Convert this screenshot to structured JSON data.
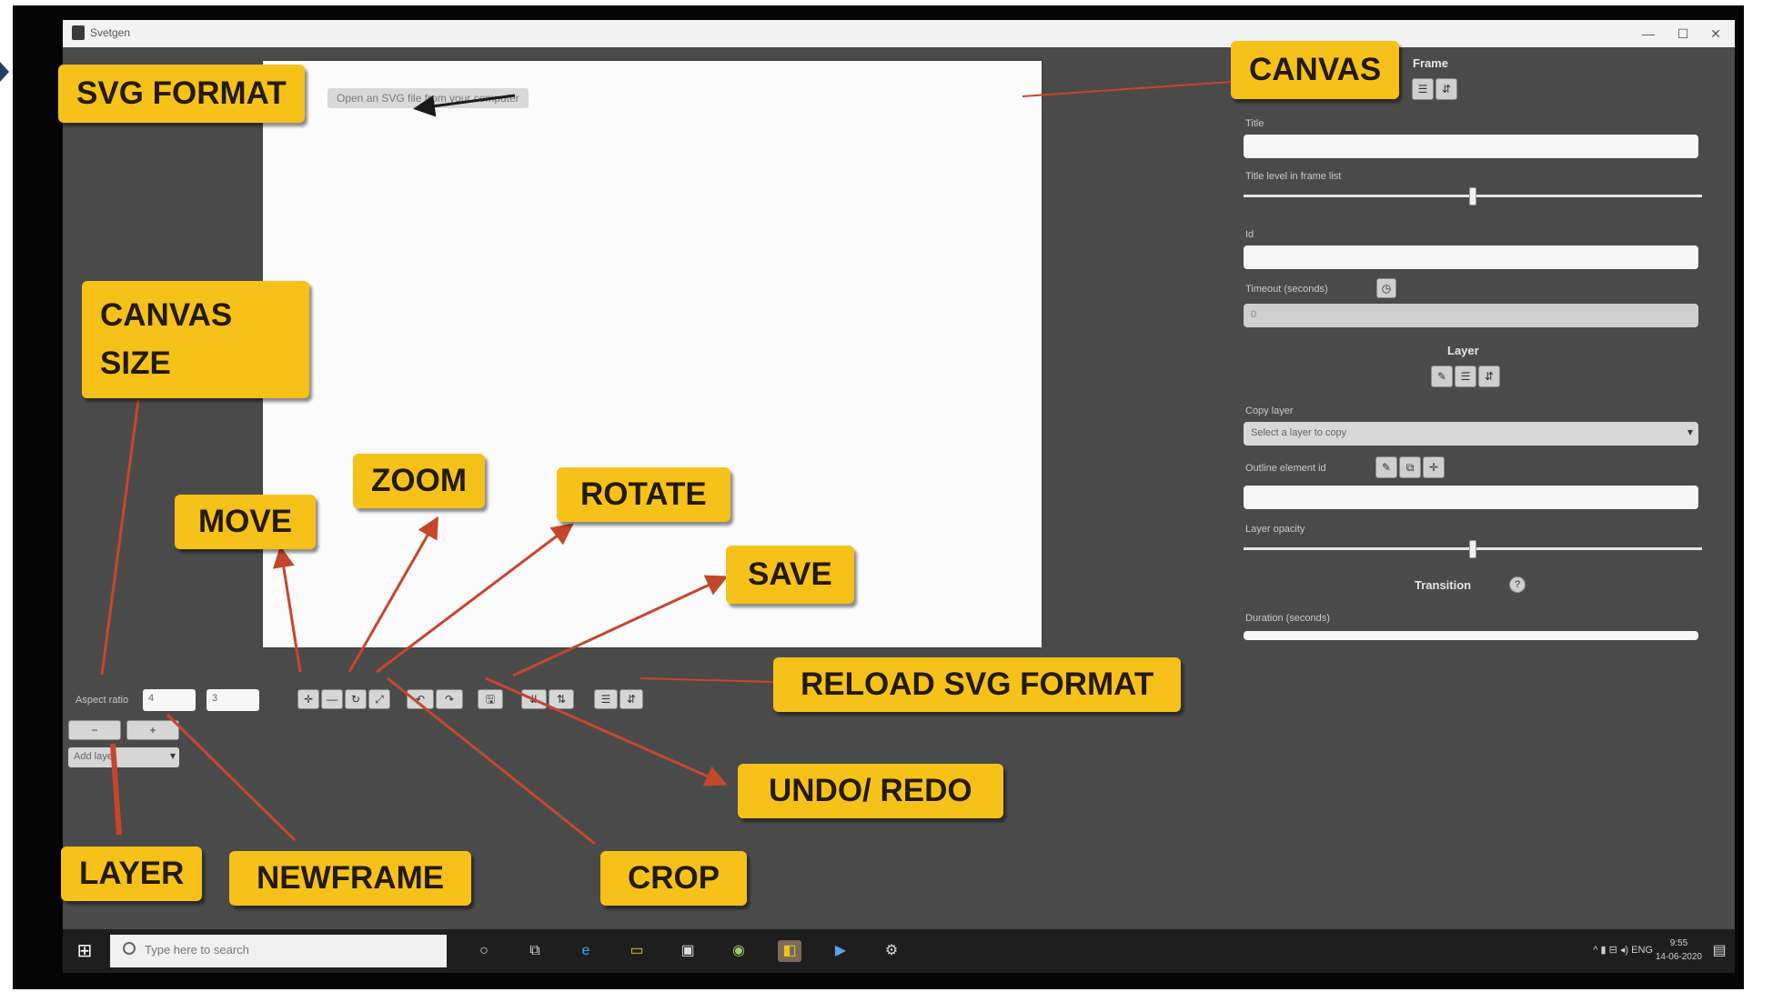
{
  "window": {
    "title": "Svetgen",
    "controls": [
      "—",
      "☐",
      "✕"
    ]
  },
  "canvas": {
    "hint": "Open an SVG file from your computer"
  },
  "right_panel": {
    "frame_heading": "Frame",
    "frame_buttons": [
      "☰",
      "⇵"
    ],
    "title_label": "Title",
    "title_value": "",
    "title_level_label": "Title level in frame list",
    "title_level": 0.5,
    "id_label": "Id",
    "id_value": "",
    "timeout_label": "Timeout (seconds)",
    "timeout_icon": "clock-icon",
    "timeout_value": "0",
    "layer_heading": "Layer",
    "layer_buttons": [
      "✎",
      "☰",
      "⇵"
    ],
    "copy_layer_label": "Copy layer",
    "copy_layer_placeholder": "Select a layer to copy",
    "outline_label": "Outline element id",
    "outline_buttons": [
      "✎",
      "⧉",
      "✛"
    ],
    "outline_value": "",
    "layer_opacity_label": "Layer opacity",
    "layer_opacity": 0.5,
    "transition_heading": "Transition",
    "duration_label": "Duration (seconds)"
  },
  "toolbar": {
    "aspect_label": "Aspect ratio",
    "aspect_w": "4",
    "aspect_h": "3",
    "move_buttons": [
      "✛",
      "—",
      "↻",
      "⤢"
    ],
    "undo_redo_buttons": [
      "↶",
      "↷"
    ],
    "save_button": "🖫",
    "reload_buttons": [
      "⇊",
      "⇅"
    ],
    "frame_buttons": [
      "☰",
      "⇵"
    ],
    "minus_button": "−",
    "plus_button": "+",
    "add_layer": "Add layer"
  },
  "taskbar": {
    "search_placeholder": "Type here to search",
    "icons": [
      "cortana-icon",
      "task-view-icon",
      "edge-icon",
      "explorer-icon",
      "store-icon",
      "chrome-icon",
      "app-icon",
      "zoom-icon",
      "settings-icon"
    ],
    "tray": "^  ▮  ⊟  ◂)  ENG",
    "time": "9:55",
    "date": "14-06-2020"
  },
  "callouts": {
    "svg_format": "SVG FORMAT",
    "canvas": "CANVAS",
    "canvas_size": "CANVAS SIZE",
    "zoom": "ZOOM",
    "move": "MOVE",
    "rotate": "ROTATE",
    "save": "SAVE",
    "reload_svg_format": "RELOAD SVG FORMAT",
    "undo_redo": "UNDO/ REDO",
    "layer": "LAYER",
    "newframe": "NEWFRAME",
    "crop": "CROP"
  },
  "colors": {
    "callout": "#f6c21a",
    "arrow": "#c4472a",
    "panel": "#4a4a4a",
    "taskbar": "#1e1e1e"
  }
}
